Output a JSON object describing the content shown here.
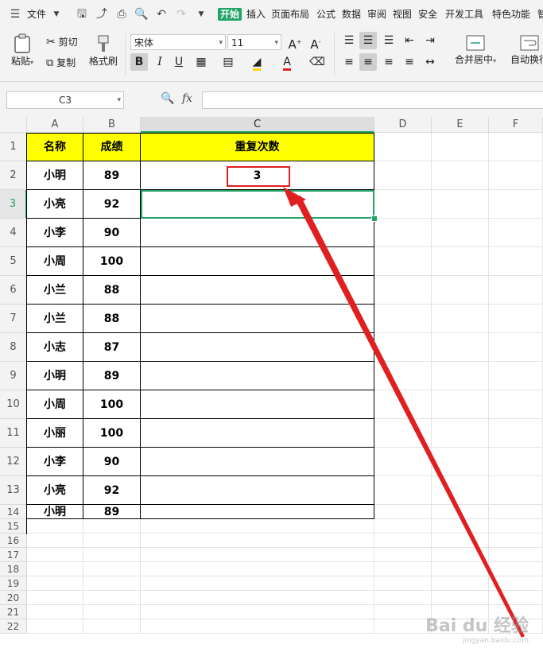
{
  "menu": {
    "file_label": "文件",
    "tabs": [
      "开始",
      "插入",
      "页面布局",
      "公式",
      "数据",
      "审阅",
      "视图",
      "安全",
      "开发工具",
      "特色功能",
      "智"
    ]
  },
  "ribbon": {
    "paste": "粘贴",
    "cut": "剪切",
    "copy": "复制",
    "format_painter": "格式刷",
    "font_name": "宋体",
    "font_size": "11",
    "merge_center": "合并居中",
    "wrap_text": "自动换行"
  },
  "formula_bar": {
    "name_box": "C3",
    "fx": "fx",
    "value": ""
  },
  "sheet": {
    "columns": [
      "A",
      "B",
      "C",
      "D",
      "E",
      "F"
    ],
    "row_numbers": [
      "1",
      "2",
      "3",
      "4",
      "5",
      "6",
      "7",
      "8",
      "9",
      "10",
      "11",
      "12",
      "13",
      "14",
      "15",
      "16",
      "17",
      "18",
      "19",
      "20",
      "21",
      "22"
    ],
    "headers": {
      "name": "名称",
      "score": "成绩",
      "repeat": "重复次数"
    },
    "rows": [
      {
        "name": "小明",
        "score": "89",
        "repeat": "3"
      },
      {
        "name": "小亮",
        "score": "92",
        "repeat": ""
      },
      {
        "name": "小李",
        "score": "90",
        "repeat": ""
      },
      {
        "name": "小周",
        "score": "100",
        "repeat": ""
      },
      {
        "name": "小兰",
        "score": "88",
        "repeat": ""
      },
      {
        "name": "小兰",
        "score": "88",
        "repeat": ""
      },
      {
        "name": "小志",
        "score": "87",
        "repeat": ""
      },
      {
        "name": "小明",
        "score": "89",
        "repeat": ""
      },
      {
        "name": "小周",
        "score": "100",
        "repeat": ""
      },
      {
        "name": "小丽",
        "score": "100",
        "repeat": ""
      },
      {
        "name": "小李",
        "score": "90",
        "repeat": ""
      },
      {
        "name": "小亮",
        "score": "92",
        "repeat": ""
      },
      {
        "name": "小明",
        "score": "89",
        "repeat": ""
      }
    ]
  },
  "colors": {
    "accent": "#21a366",
    "header_fill": "#ffff00",
    "annotation": "#e02020"
  },
  "watermark": {
    "text": "Bai du 经验",
    "sub": "jingyan.baidu.com"
  }
}
